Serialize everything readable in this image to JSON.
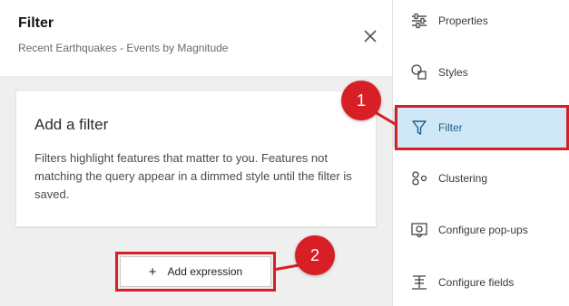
{
  "panel": {
    "title": "Filter",
    "subtitle": "Recent Earthquakes - Events by Magnitude",
    "close_icon": "close-icon"
  },
  "card": {
    "title": "Add a filter",
    "description": "Filters highlight features that matter to you. Features not matching the query appear in a dimmed style until the filter is saved."
  },
  "add_expression": {
    "plus": "+",
    "label": "Add expression"
  },
  "menu": {
    "items": [
      {
        "label": "Properties",
        "icon": "sliders-icon",
        "active": false
      },
      {
        "label": "Styles",
        "icon": "shapes-icon",
        "active": false
      },
      {
        "label": "Filter",
        "icon": "funnel-icon",
        "active": true
      },
      {
        "label": "Clustering",
        "icon": "cluster-icon",
        "active": false
      },
      {
        "label": "Configure pop-ups",
        "icon": "popup-icon",
        "active": false
      },
      {
        "label": "Configure fields",
        "icon": "fields-icon",
        "active": false
      }
    ]
  },
  "callouts": [
    "1",
    "2"
  ],
  "colors": {
    "accent_red": "#d91f26",
    "active_bg": "#cfe7f7",
    "panel_bg": "#efefef"
  }
}
